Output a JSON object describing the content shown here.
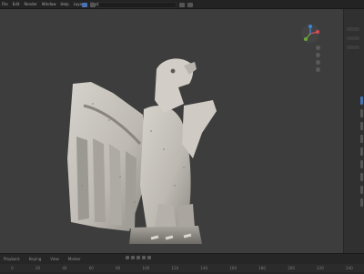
{
  "menu": [
    "File",
    "Edit",
    "Render",
    "Window",
    "Help",
    "Layout",
    "Modeling",
    "Sculpting"
  ],
  "timeline_numbers": [
    "0",
    "20",
    "40",
    "60",
    "80",
    "100",
    "120",
    "140",
    "160",
    "180",
    "200",
    "220",
    "240"
  ],
  "frame_labels": [
    "Playback",
    "Keying",
    "View",
    "Marker"
  ],
  "colors": {
    "accent": "#4772b3",
    "viewport_bg": "#3d3d3d",
    "panel_bg": "#303030",
    "gizmo_x": "#d84a57",
    "gizmo_y": "#6ea638",
    "gizmo_z": "#3c86d8"
  },
  "icons": [
    "navigation-gizmo-icon",
    "zoom-icon",
    "pan-icon",
    "camera-icon",
    "perspective-icon",
    "play-icon"
  ]
}
